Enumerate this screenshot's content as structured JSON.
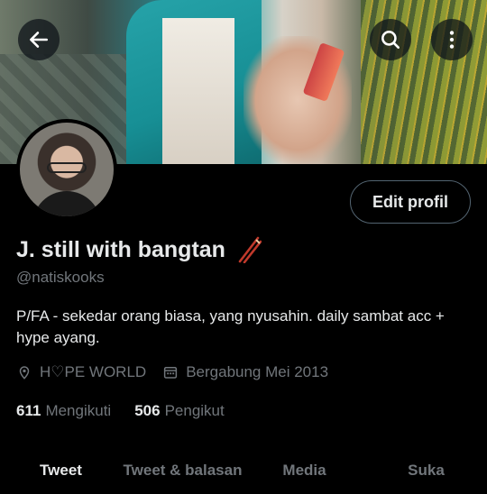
{
  "profile": {
    "display_name": "J. still with bangtan",
    "handle": "@natiskooks",
    "bio": "P/FA - sekedar orang biasa, yang nyusahin. daily sambat acc + hype ayang.",
    "location": "H♡PE WORLD",
    "joined": "Bergabung Mei 2013",
    "following_count": "611",
    "following_label": "Mengikuti",
    "followers_count": "506",
    "followers_label": "Pengikut"
  },
  "actions": {
    "edit_profile_label": "Edit profil"
  },
  "tabs": [
    {
      "label": "Tweet",
      "active": true
    },
    {
      "label": "Tweet & balasan",
      "active": false
    },
    {
      "label": "Media",
      "active": false
    },
    {
      "label": "Suka",
      "active": false
    }
  ],
  "icons": {
    "back": "arrow-left-icon",
    "search": "search-icon",
    "more": "more-vertical-icon",
    "location": "location-pin-icon",
    "calendar": "calendar-icon",
    "name_emoji": "chopsticks-icon"
  },
  "colors": {
    "background": "#000000",
    "primary_text": "#e7e9ea",
    "secondary_text": "#71767b",
    "border": "#536471",
    "emoji_red": "#c0392b"
  }
}
